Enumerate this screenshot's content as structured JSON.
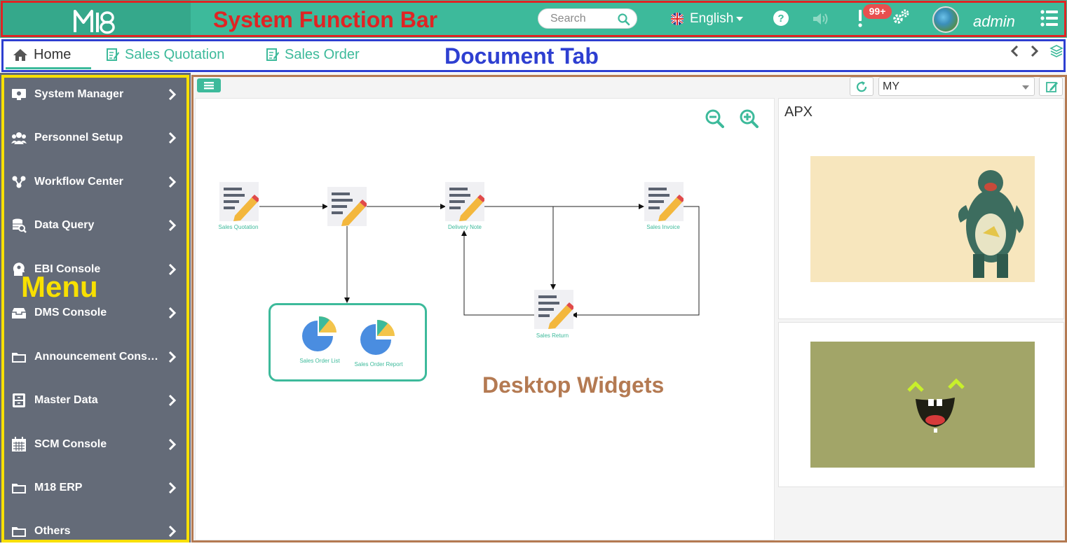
{
  "annotations": {
    "system_bar": "System Function Bar",
    "document_tab": "Document Tab",
    "menu": "Menu",
    "desktop": "Desktop Widgets"
  },
  "topbar": {
    "search_placeholder": "Search",
    "language": "English",
    "notification_count": "99+",
    "username": "admin",
    "colors": {
      "bar": "#3dba9b",
      "logo_area": "#35a88b",
      "badge": "#e84f4f"
    }
  },
  "tabs": [
    {
      "label": "Home",
      "icon": "home-icon"
    },
    {
      "label": "Sales Quotation",
      "icon": "document-edit-icon"
    },
    {
      "label": "Sales Order",
      "icon": "document-edit-icon"
    }
  ],
  "menu": [
    {
      "label": "System Manager",
      "icon": "monitor-gear-icon"
    },
    {
      "label": "Personnel Setup",
      "icon": "users-icon"
    },
    {
      "label": "Workflow Center",
      "icon": "workflow-icon"
    },
    {
      "label": "Data Query",
      "icon": "database-search-icon"
    },
    {
      "label": "EBI Console",
      "icon": "head-gear-icon"
    },
    {
      "label": "DMS Console",
      "icon": "drawer-icon"
    },
    {
      "label": "Announcement Cons…",
      "icon": "folder-icon"
    },
    {
      "label": "Master Data",
      "icon": "cabinet-icon"
    },
    {
      "label": "SCM Console",
      "icon": "calendar-icon"
    },
    {
      "label": "M18 ERP",
      "icon": "folder-icon"
    },
    {
      "label": "Others",
      "icon": "folder-icon"
    }
  ],
  "desktop": {
    "selector_value": "MY",
    "flow": {
      "nodes": [
        "Sales Quotation",
        "",
        "Delivery Note",
        "Sales Invoice",
        "Sales Return"
      ],
      "group": [
        "Sales Order List",
        "Sales Order Report"
      ]
    },
    "side_widget_title": "APX"
  }
}
